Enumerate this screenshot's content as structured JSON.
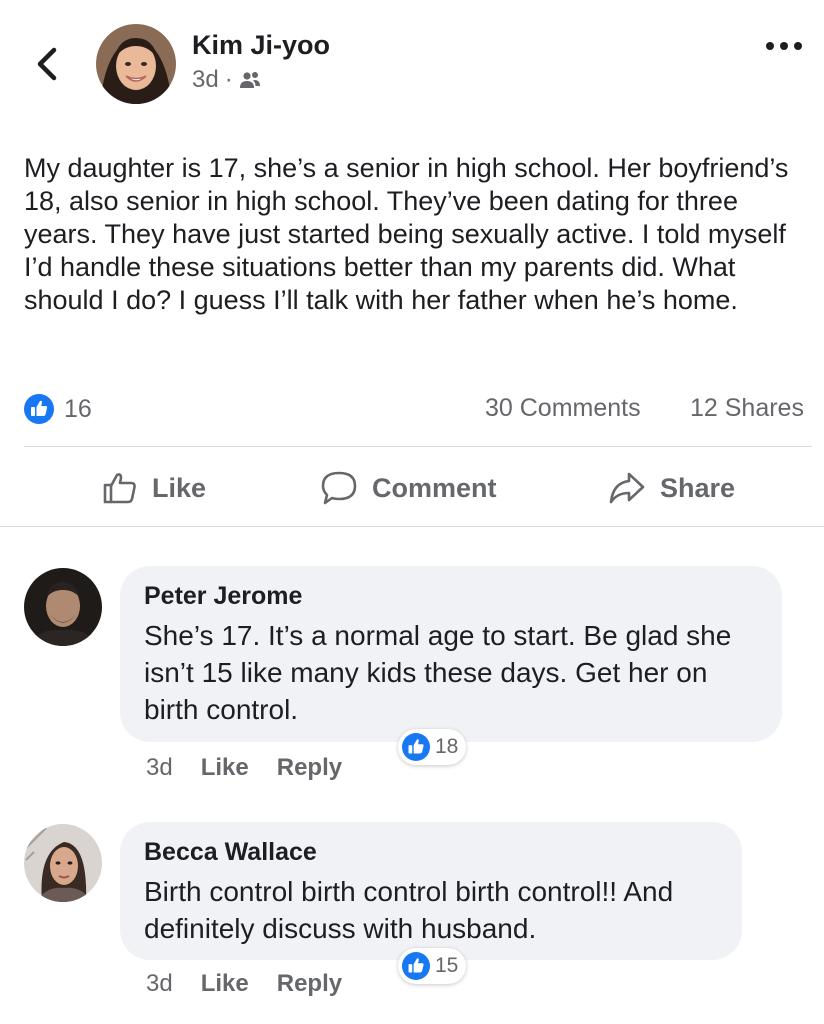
{
  "post": {
    "author_name": "Kim Ji-yoo",
    "time": "3d",
    "meta_separator": "·",
    "audience_icon": "friends-icon",
    "text": "My daughter is 17, she’s a senior in high school. Her boyfriend’s 18, also senior in high school. They’ve been dating for three years. They have just started being sexually active. I told myself I’d handle these situations better than my parents did. What should I do? I guess I’ll talk with her father when he’s home.",
    "like_count": "16",
    "comments_count": "30 Comments",
    "shares_count": "12 Shares"
  },
  "actions": {
    "like_label": "Like",
    "comment_label": "Comment",
    "share_label": "Share"
  },
  "comments": [
    {
      "name": "Peter Jerome",
      "text": "She’s 17. It’s a normal age to start. Be glad she isn’t 15 like many kids these days. Get her on birth control.",
      "time": "3d",
      "like_label": "Like",
      "reply_label": "Reply",
      "reaction_count": "18"
    },
    {
      "name": "Becca Wallace",
      "text": "Birth control birth control birth control!! And definitely discuss with husband.",
      "time": "3d",
      "like_label": "Like",
      "reply_label": "Reply",
      "reaction_count": "15"
    }
  ],
  "colors": {
    "like_blue": "#1877f2",
    "secondary_text": "#65676b",
    "bubble_bg": "#f0f2f5"
  }
}
